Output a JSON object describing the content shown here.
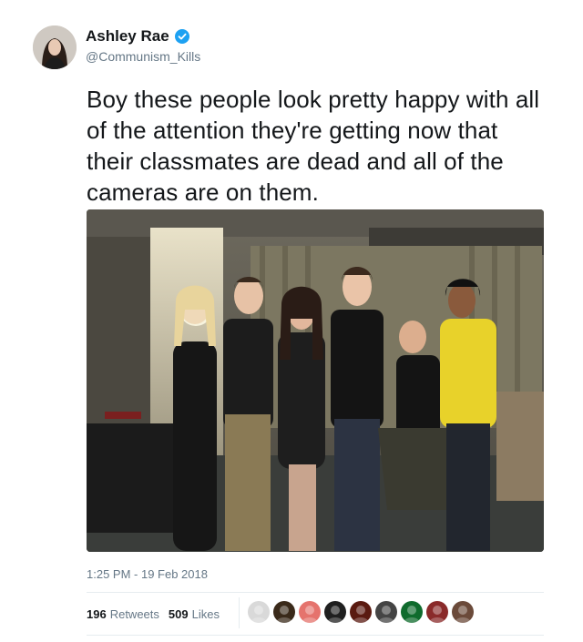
{
  "author": {
    "name": "Ashley Rae",
    "handle": "@Communism_Kills",
    "verified": true,
    "avatar_icon": "user-avatar"
  },
  "tweet": {
    "text": "Boy these people look pretty happy with all of the attention they're getting now that their classmates are dead and all of the cameras are on them."
  },
  "media": {
    "photo_icon": "group-photo"
  },
  "meta": {
    "timestamp": "1:25 PM - 19 Feb 2018"
  },
  "stats": {
    "retweets_count": "196",
    "retweets_label": "Retweets",
    "likes_count": "509",
    "likes_label": "Likes"
  },
  "likers": [
    {
      "icon": "liker-avatar-1",
      "color": "#d9d9d9"
    },
    {
      "icon": "liker-avatar-2",
      "color": "#3a2a1a"
    },
    {
      "icon": "liker-avatar-3",
      "color": "#e5736d"
    },
    {
      "icon": "liker-avatar-4",
      "color": "#1f1f1f"
    },
    {
      "icon": "liker-avatar-5",
      "color": "#5a1a10"
    },
    {
      "icon": "liker-avatar-6",
      "color": "#444444"
    },
    {
      "icon": "liker-avatar-7",
      "color": "#0f6b2d"
    },
    {
      "icon": "liker-avatar-8",
      "color": "#8a2a2a"
    },
    {
      "icon": "liker-avatar-9",
      "color": "#6b4a3a"
    }
  ],
  "colors": {
    "verified": "#1da1f2",
    "secondary_text": "#657786",
    "primary_text": "#14171a"
  }
}
